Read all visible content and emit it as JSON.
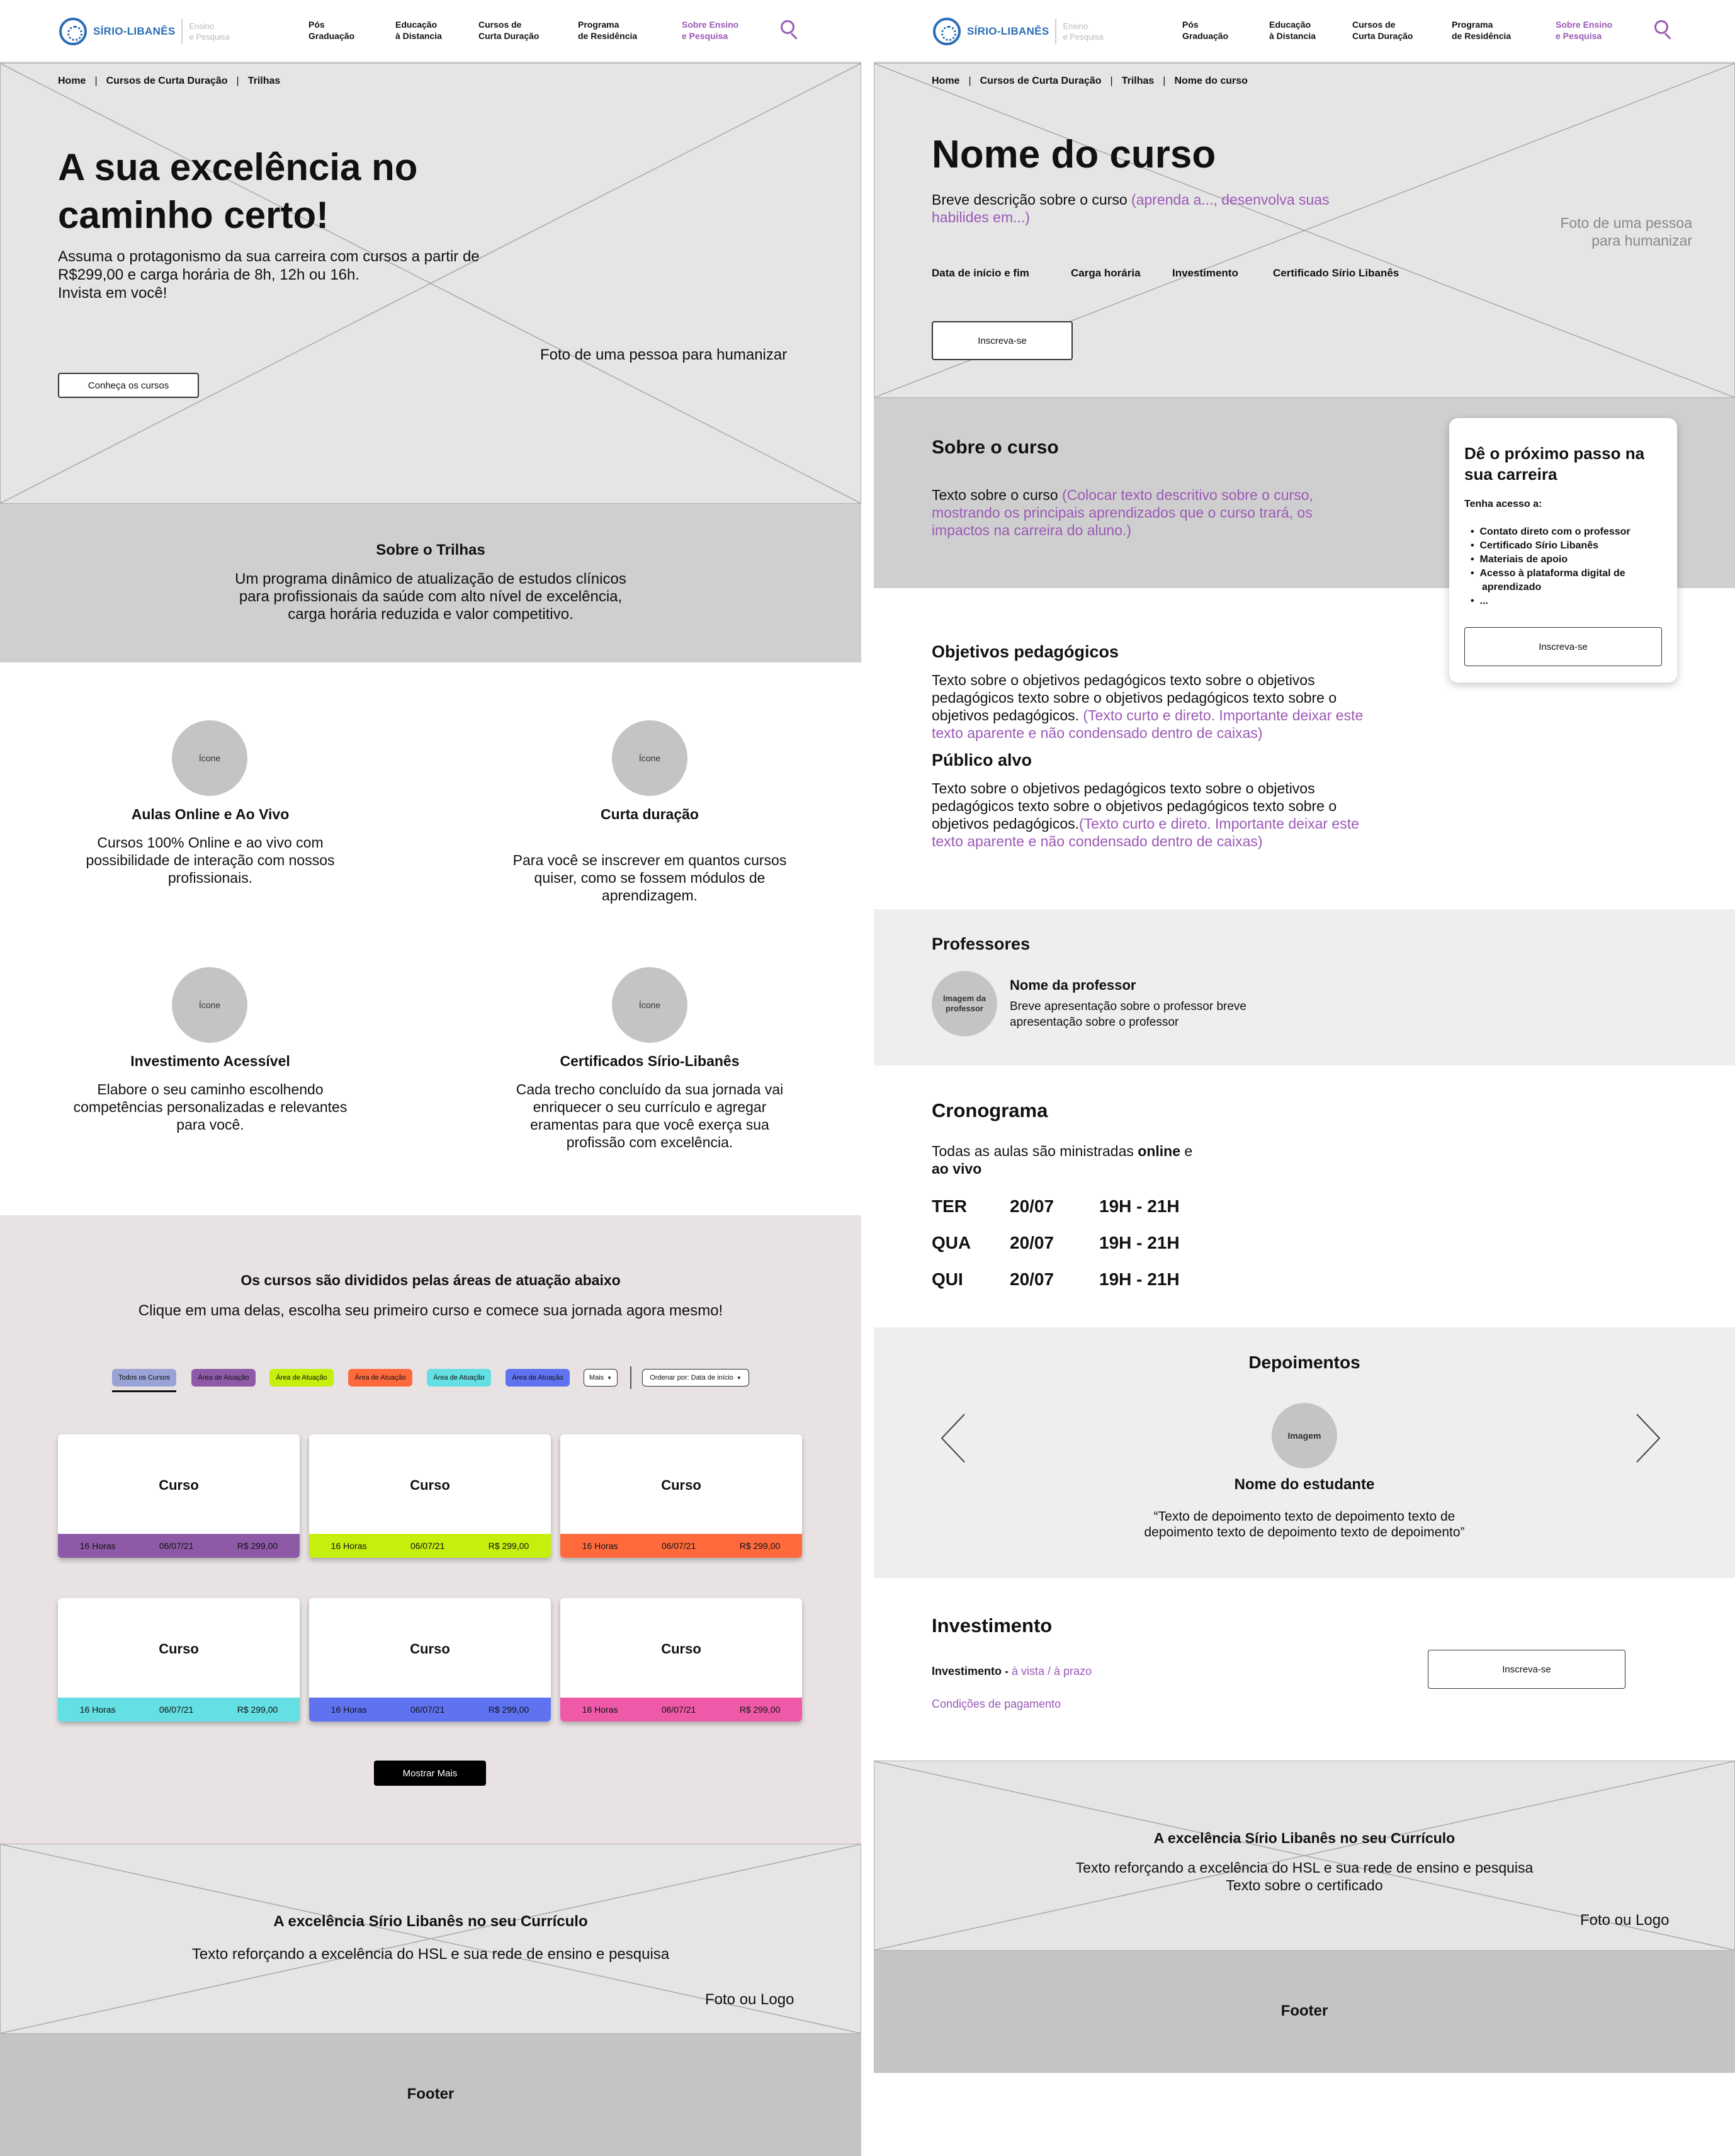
{
  "nav": {
    "logo_name": "SÍRIO-LIBANÊS",
    "logo_sub_1": "Ensino",
    "logo_sub_2": "e Pesquisa",
    "items": [
      {
        "l1": "Pós",
        "l2": "Graduação"
      },
      {
        "l1": "Educação",
        "l2": "à Distancia"
      },
      {
        "l1": "Cursos de",
        "l2": "Curta Duração"
      },
      {
        "l1": "Programa",
        "l2": "de Residência"
      },
      {
        "l1": "Sobre Ensino",
        "l2": "e Pesquisa"
      }
    ],
    "search_icon": "search-icon"
  },
  "left": {
    "breadcrumb": [
      "Home",
      "Cursos de Curta Duração",
      "Trilhas"
    ],
    "hero": {
      "title_1": "A sua excelência no",
      "title_2": "caminho certo!",
      "desc_1": "Assuma o protagonismo da sua carreira com cursos a partir de",
      "desc_2": "R$299,00 e carga horária de 8h, 12h ou 16h.",
      "desc_3": "Invista em você!",
      "button": "Conheça os cursos",
      "photo": "Foto de uma pessoa para humanizar"
    },
    "about": {
      "title": "Sobre o Trilhas",
      "l1": "Um programa dinâmico de atualização de estudos clínicos",
      "l2": "para profissionais da saúde com alto nível de excelência,",
      "l3": "carga horária reduzida e valor competitivo."
    },
    "features": [
      {
        "icon": "Ícone",
        "title": "Aulas Online e Ao Vivo",
        "l1": "Cursos 100% Online e ao vivo com",
        "l2": "possibilidade de interação com nossos",
        "l3": "profissionais.",
        "l4": ""
      },
      {
        "icon": "Ícone",
        "title": "Curta duração",
        "l1": "Para você se inscrever em quantos cursos",
        "l2": "quiser, como se fossem módulos de",
        "l3": "aprendizagem.",
        "l4": ""
      },
      {
        "icon": "Ícone",
        "title": "Investimento Acessível",
        "l1": "Elabore o seu caminho escolhendo",
        "l2": "competências personalizadas e relevantes",
        "l3": "para você.",
        "l4": ""
      },
      {
        "icon": "Ícone",
        "title": "Certificados Sírio-Libanês",
        "l1": "Cada trecho concluído da sua jornada vai",
        "l2": "enriquecer o seu currículo e agregar",
        "l3": "eramentas para que você exerça sua",
        "l4": "profissão com excelência."
      }
    ],
    "areas": {
      "title": "Os cursos são divididos pelas áreas de atuação abaixo",
      "subtitle": "Clique em uma delas, escolha seu primeiro curso e comece sua jornada agora mesmo!",
      "chips": [
        {
          "label": "Todos os Cursos",
          "color": "#9aa3d6"
        },
        {
          "label": "Área de Atuação",
          "color": "#8e5aa8"
        },
        {
          "label": "Área de Atuação",
          "color": "#c5ef0c"
        },
        {
          "label": "Área de Atuação",
          "color": "#ff6a3d"
        },
        {
          "label": "Área de Atuação",
          "color": "#64dfe3"
        },
        {
          "label": "Área de Atuação",
          "color": "#5f73f0"
        }
      ],
      "more": "Mais",
      "sort": "Ordenar por: Data de início",
      "cards": [
        {
          "title": "Curso",
          "hours": "16 Horas",
          "date": "06/07/21",
          "price": "R$ 299,00",
          "color": "#8e5aa8"
        },
        {
          "title": "Curso",
          "hours": "16 Horas",
          "date": "06/07/21",
          "price": "R$ 299,00",
          "color": "#c5ef0c"
        },
        {
          "title": "Curso",
          "hours": "16 Horas",
          "date": "06/07/21",
          "price": "R$ 299,00",
          "color": "#ff6a3d"
        },
        {
          "title": "Curso",
          "hours": "16 Horas",
          "date": "06/07/21",
          "price": "R$ 299,00",
          "color": "#64dfe3"
        },
        {
          "title": "Curso",
          "hours": "16 Horas",
          "date": "06/07/21",
          "price": "R$ 299,00",
          "color": "#5f73f0"
        },
        {
          "title": "Curso",
          "hours": "16 Horas",
          "date": "06/07/21",
          "price": "R$ 299,00",
          "color": "#ee5aa8"
        }
      ],
      "show_more": "Mostrar Mais"
    },
    "excellence": {
      "title": "A excelência Sírio Libanês no seu Currículo",
      "text": "Texto reforçando a excelência do HSL e sua rede de ensino e pesquisa",
      "photo": "Foto ou Logo"
    },
    "footer": "Footer"
  },
  "right": {
    "breadcrumb": [
      "Home",
      "Cursos de Curta Duração",
      "Trilhas",
      "Nome do curso"
    ],
    "hero": {
      "title": "Nome do curso",
      "desc_plain": "Breve descrição sobre o curso ",
      "desc_purple_1": "(aprenda a..., desenvolva suas",
      "desc_purple_2": "habilides em...)",
      "photo_1": "Foto de uma pessoa",
      "photo_2": "para humanizar",
      "meta": [
        "Data de início e fim",
        "Carga horária",
        "Investimento",
        "Certificado Sírio Libanês"
      ],
      "button": "Inscreva-se"
    },
    "about": {
      "title": "Sobre o curso",
      "plain": "Texto sobre o curso ",
      "p1": "(Colocar texto descritivo sobre o curso,",
      "p2": "mostrando os principais aprendizados que o curso trará, os",
      "p3": "impactos na carreira do aluno.)"
    },
    "cta_card": {
      "title_1": "Dê o próximo passo na",
      "title_2": "sua carreira",
      "access": "Tenha acesso a:",
      "items": [
        "Contato direto com o professor",
        "Certificado Sírio Libanês",
        "Materiais de apoio",
        "Acesso à plataforma digital de",
        "aprendizado",
        "..."
      ],
      "button": "Inscreva-se"
    },
    "objectives": {
      "title": "Objetivos pedagógicos",
      "l1": "Texto sobre o objetivos pedagógicos texto sobre o objetivos",
      "l2": "pedagógicos texto sobre o objetivos pedagógicos texto sobre o",
      "l3": "objetivos pedagógicos. ",
      "l3p": "(Texto curto e direto. Importante deixar este",
      "l4p": "texto aparente e não condensado dentro de caixas)"
    },
    "audience": {
      "title": "Público alvo",
      "l1": "Texto sobre o objetivos pedagógicos texto sobre o objetivos",
      "l2": "pedagógicos texto sobre o objetivos pedagógicos texto sobre o",
      "l3": "objetivos pedagógicos.",
      "l3p": "(Texto curto e direto. Importante deixar este",
      "l4p": "texto aparente e não condensado dentro de caixas)"
    },
    "professors": {
      "title": "Professores",
      "img_1": "Imagem da",
      "img_2": "professor",
      "name": "Nome da professor",
      "b1": "Breve apresentação sobre o professor breve",
      "b2": "apresentação sobre o professor"
    },
    "schedule": {
      "title": "Cronograma",
      "l1_plain": "Todas as aulas são ministradas ",
      "l1_bold": "online",
      "l1_end": " e",
      "l2_bold": "ao vivo",
      "rows": [
        {
          "day": "TER",
          "date": "20/07",
          "time": "19H - 21H"
        },
        {
          "day": "QUA",
          "date": "20/07",
          "time": "19H - 21H"
        },
        {
          "day": "QUI",
          "date": "20/07",
          "time": "19H - 21H"
        }
      ]
    },
    "testimonials": {
      "title": "Depoimentos",
      "image": "Imagem",
      "name": "Nome do estudante",
      "q1": "“Texto de depoimento texto de depoimento texto de",
      "q2": "depoimento texto de depoimento texto de depoimento”"
    },
    "investment": {
      "title": "Investimento",
      "label": "Investimento - ",
      "value": "à vista / à prazo",
      "conditions": "Condições de pagamento",
      "button": "Inscreva-se"
    },
    "excellence": {
      "title": "A excelência Sírio Libanês no seu Currículo",
      "t1": "Texto reforçando a excelência do HSL e sua rede de ensino e pesquisa",
      "t2": "Texto sobre o certificado",
      "photo": "Foto ou Logo"
    },
    "footer": "Footer"
  }
}
